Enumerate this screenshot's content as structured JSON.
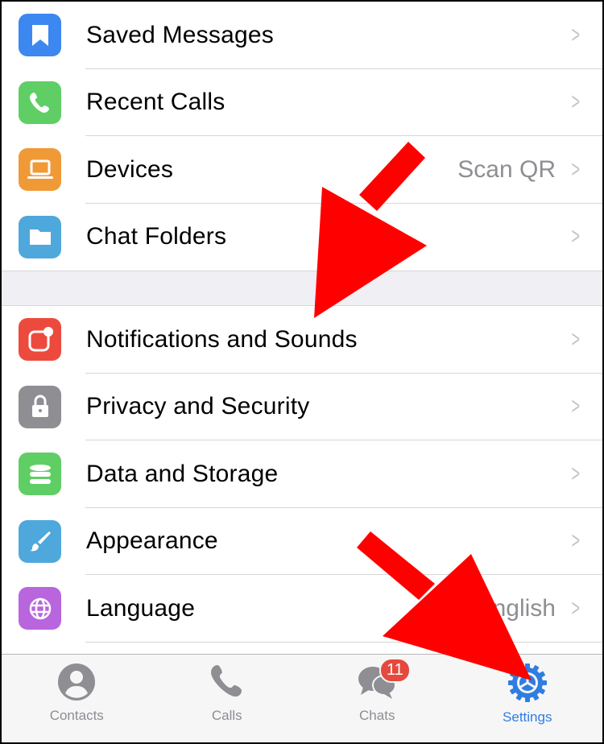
{
  "groups": [
    [
      {
        "label": "Saved Messages",
        "icon": "bookmark-icon",
        "color": "#3d87f0"
      },
      {
        "label": "Recent Calls",
        "icon": "phone-icon",
        "color": "#5fcf65"
      },
      {
        "label": "Devices",
        "icon": "laptop-icon",
        "color": "#f09a37",
        "value": "Scan QR"
      },
      {
        "label": "Chat Folders",
        "icon": "folder-icon",
        "color": "#4fa8dc"
      }
    ],
    [
      {
        "label": "Notifications and Sounds",
        "icon": "notification-icon",
        "color": "#ed4a3e"
      },
      {
        "label": "Privacy and Security",
        "icon": "lock-icon",
        "color": "#8e8e93"
      },
      {
        "label": "Data and Storage",
        "icon": "database-icon",
        "color": "#5fcf65"
      },
      {
        "label": "Appearance",
        "icon": "brush-icon",
        "color": "#4fa8dc"
      },
      {
        "label": "Language",
        "icon": "globe-icon",
        "color": "#b865de",
        "value": "English"
      }
    ]
  ],
  "tabs": [
    {
      "label": "Contacts",
      "icon": "person-icon"
    },
    {
      "label": "Calls",
      "icon": "phone-icon"
    },
    {
      "label": "Chats",
      "icon": "chat-bubbles-icon",
      "badge": "11"
    },
    {
      "label": "Settings",
      "icon": "gear-icon",
      "active": true
    }
  ],
  "colors": {
    "accent": "#2f7de1",
    "annotation": "#ff0000",
    "badge": "#e5483d"
  }
}
